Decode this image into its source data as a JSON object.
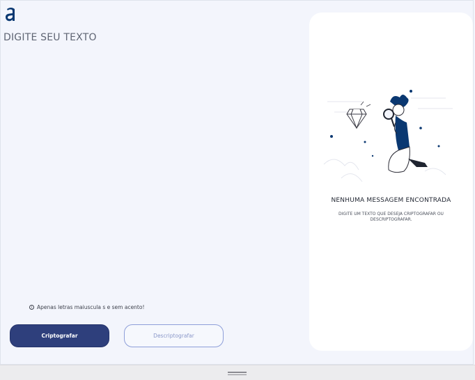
{
  "header": {
    "logo_icon": "alura-a-logo",
    "logo_color": "#0a3871"
  },
  "input": {
    "placeholder": "DIGITE SEU TEXTO",
    "value": ""
  },
  "hint": {
    "icon": "info-icon",
    "text": "Apenas letras maiuscula s e sem acento!"
  },
  "buttons": {
    "encrypt_label": "Criptografar",
    "decrypt_label": "Descriptografar"
  },
  "result": {
    "illustration": "person-with-magnifying-glass-and-diamond",
    "title": "NENHUMA MESSAGEM ENCONTRADA",
    "description": "DIGITE UM TEXTO QUE DESEJA CRIPTOGRAFAR OU DESCRIPTOGRAFAR."
  },
  "colors": {
    "primary": "#2e3f7c",
    "background": "#f3f5fc",
    "accent": "#0a3871"
  },
  "footer": {
    "handle_icon": "drag-handle-icon"
  }
}
